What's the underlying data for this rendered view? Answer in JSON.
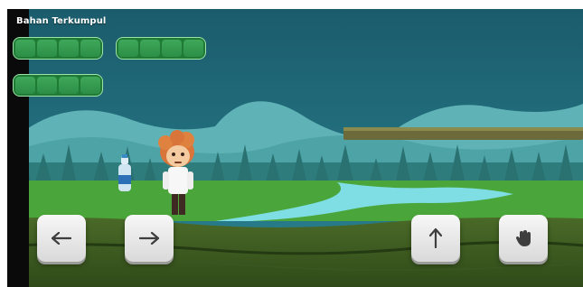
{
  "hud": {
    "title": "Bahan Terkumpul",
    "slot_groups": [
      {
        "slots": 4
      },
      {
        "slots": 4
      },
      {
        "slots": 4
      }
    ]
  },
  "controls": {
    "left": {
      "icon": "arrow-left-icon"
    },
    "right": {
      "icon": "arrow-right-icon"
    },
    "jump": {
      "icon": "arrow-up-icon"
    },
    "grab": {
      "icon": "hand-icon"
    }
  },
  "colors": {
    "sky": "#1f6a78",
    "mountain": "#5fb3b6",
    "forest": "#2e7d7c",
    "grass": "#4aa63a",
    "river": "#7fdde4",
    "ground": "#3d5a22",
    "hud_slot": "#2f9a4b"
  },
  "items": [
    {
      "type": "water-bottle"
    }
  ],
  "character": {
    "type": "scientist"
  }
}
